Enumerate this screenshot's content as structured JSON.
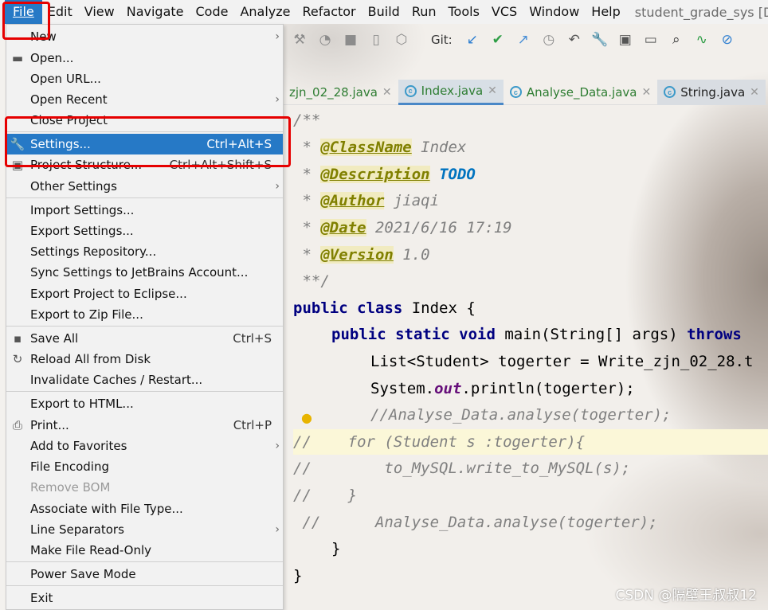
{
  "menubar": {
    "items": [
      "File",
      "Edit",
      "View",
      "Navigate",
      "Code",
      "Analyze",
      "Refactor",
      "Build",
      "Run",
      "Tools",
      "VCS",
      "Window",
      "Help"
    ],
    "title": "student_grade_sys [D:\\IdeaP"
  },
  "toolbar": {
    "git_label": "Git:"
  },
  "tabs": [
    {
      "label": "zjn_02_28.java",
      "active": false
    },
    {
      "label": "Index.java",
      "active": true
    },
    {
      "label": "Analyse_Data.java",
      "active": false
    },
    {
      "label": "String.java",
      "active": false
    }
  ],
  "file_menu": {
    "items": [
      {
        "label": "New",
        "shortcut": "",
        "submenu": true,
        "icon": ""
      },
      {
        "label": "Open...",
        "shortcut": "",
        "submenu": false,
        "icon": "folder-icon"
      },
      {
        "label": "Open URL...",
        "shortcut": "",
        "submenu": false,
        "icon": ""
      },
      {
        "label": "Open Recent",
        "shortcut": "",
        "submenu": true,
        "icon": ""
      },
      {
        "label": "Close Project",
        "shortcut": "",
        "submenu": false,
        "icon": ""
      },
      {
        "label": "Settings...",
        "shortcut": "Ctrl+Alt+S",
        "submenu": false,
        "icon": "wrench-icon",
        "selected": true
      },
      {
        "label": "Project Structure...",
        "shortcut": "Ctrl+Alt+Shift+S",
        "submenu": false,
        "icon": "project-structure-icon"
      },
      {
        "label": "Other Settings",
        "shortcut": "",
        "submenu": true,
        "icon": ""
      },
      {
        "label": "Import Settings...",
        "shortcut": "",
        "submenu": false,
        "icon": ""
      },
      {
        "label": "Export Settings...",
        "shortcut": "",
        "submenu": false,
        "icon": ""
      },
      {
        "label": "Settings Repository...",
        "shortcut": "",
        "submenu": false,
        "icon": ""
      },
      {
        "label": "Sync Settings to JetBrains Account...",
        "shortcut": "",
        "submenu": false,
        "icon": ""
      },
      {
        "label": "Export Project to Eclipse...",
        "shortcut": "",
        "submenu": false,
        "icon": ""
      },
      {
        "label": "Export to Zip File...",
        "shortcut": "",
        "submenu": false,
        "icon": ""
      },
      {
        "label": "Save All",
        "shortcut": "Ctrl+S",
        "submenu": false,
        "icon": "save-icon"
      },
      {
        "label": "Reload All from Disk",
        "shortcut": "",
        "submenu": false,
        "icon": "reload-icon"
      },
      {
        "label": "Invalidate Caches / Restart...",
        "shortcut": "",
        "submenu": false,
        "icon": ""
      },
      {
        "label": "Export to HTML...",
        "shortcut": "",
        "submenu": false,
        "icon": ""
      },
      {
        "label": "Print...",
        "shortcut": "Ctrl+P",
        "submenu": false,
        "icon": "print-icon"
      },
      {
        "label": "Add to Favorites",
        "shortcut": "",
        "submenu": true,
        "icon": ""
      },
      {
        "label": "File Encoding",
        "shortcut": "",
        "submenu": false,
        "icon": ""
      },
      {
        "label": "Remove BOM",
        "shortcut": "",
        "submenu": false,
        "icon": "",
        "disabled": true
      },
      {
        "label": "Associate with File Type...",
        "shortcut": "",
        "submenu": false,
        "icon": ""
      },
      {
        "label": "Line Separators",
        "shortcut": "",
        "submenu": true,
        "icon": ""
      },
      {
        "label": "Make File Read-Only",
        "shortcut": "",
        "submenu": false,
        "icon": ""
      },
      {
        "label": "Power Save Mode",
        "shortcut": "",
        "submenu": false,
        "icon": ""
      },
      {
        "label": "Exit",
        "shortcut": "",
        "submenu": false,
        "icon": ""
      }
    ]
  },
  "code": {
    "doc_open": "/**",
    "doc_star": " * ",
    "tag_classname": "@ClassName",
    "val_classname": " Index",
    "tag_description": "@Description",
    "val_description": "TODO",
    "tag_author": "@Author",
    "val_author": " jiaqi",
    "tag_date": "@Date",
    "val_date": " 2021/6/16 17:19",
    "tag_version": "@Version",
    "val_version": " 1.0",
    "doc_close": " **/",
    "kw_public_class": "public class",
    "class_decl_rest": " Index {",
    "kw_public_static_void": "public static void",
    "main_sig": " main(String[] args) ",
    "kw_throws": "throws",
    "list_line": "List<Student> togerter = Write_zjn_02_28.t",
    "sys_pre": "System.",
    "sys_out": "out",
    "sys_post": ".println(togerter);",
    "comment_analyse": "//Analyse_Data.analyse(togerter);",
    "comment_for_prefix": "//",
    "comment_for": "  for (Student s :togerter){",
    "comment_mysql_prefix": "//",
    "comment_mysql": "      to_MySQL.write_to_MySQL(s);",
    "comment_brace_prefix": "//",
    "comment_brace": "  }",
    "comment_analyse2_prefix": " //",
    "comment_analyse2": "    Analyse_Data.analyse(togerter);",
    "close_inner": "}",
    "close_outer": "}"
  },
  "watermark": "CSDN @隔壁王叔叔12"
}
